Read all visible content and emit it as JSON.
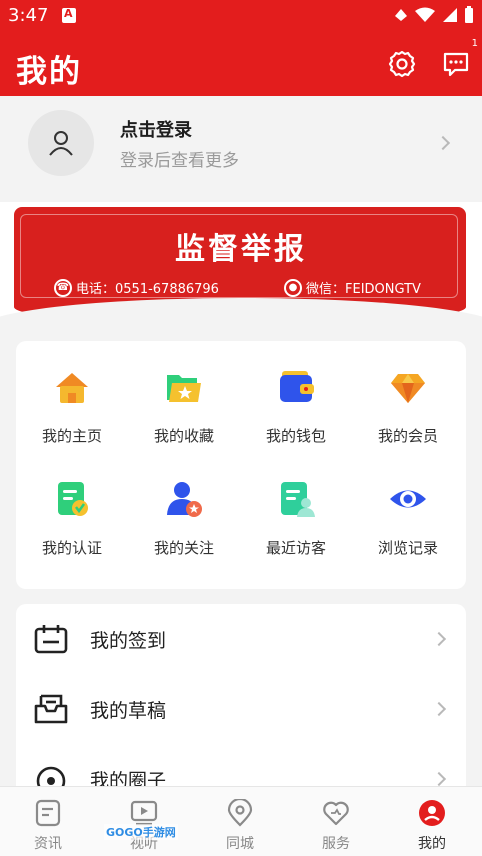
{
  "status_bar": {
    "time": "3:47"
  },
  "header": {
    "title": "我的",
    "message_badge": "1"
  },
  "login": {
    "title": "点击登录",
    "subtitle": "登录后查看更多"
  },
  "banner": {
    "title": "监督举报",
    "phone_text": "电话：0551-67886796",
    "wechat_text": "微信：FEIDONGTV"
  },
  "grid": [
    {
      "label": "我的主页",
      "icon": "home-icon"
    },
    {
      "label": "我的收藏",
      "icon": "folder-star-icon"
    },
    {
      "label": "我的钱包",
      "icon": "wallet-icon"
    },
    {
      "label": "我的会员",
      "icon": "diamond-icon"
    },
    {
      "label": "我的认证",
      "icon": "certify-icon"
    },
    {
      "label": "我的关注",
      "icon": "follow-icon"
    },
    {
      "label": "最近访客",
      "icon": "visitor-icon"
    },
    {
      "label": "浏览记录",
      "icon": "eye-icon"
    }
  ],
  "list": [
    {
      "label": "我的签到",
      "icon": "calendar-icon"
    },
    {
      "label": "我的草稿",
      "icon": "inbox-icon"
    },
    {
      "label": "我的圈子",
      "icon": "circle-icon"
    }
  ],
  "bottom_nav": [
    {
      "label": "资讯",
      "icon": "news-icon",
      "active": false
    },
    {
      "label": "视听",
      "icon": "video-icon",
      "active": false
    },
    {
      "label": "同城",
      "icon": "location-icon",
      "active": false
    },
    {
      "label": "服务",
      "icon": "heart-icon",
      "active": false
    },
    {
      "label": "我的",
      "icon": "profile-icon",
      "active": true
    }
  ],
  "watermark": "GOGO手游网",
  "colors": {
    "brand_red": "#e31d1d",
    "icon_blue": "#2f54eb",
    "icon_green": "#2fcf7b",
    "icon_orange": "#f5a623"
  }
}
